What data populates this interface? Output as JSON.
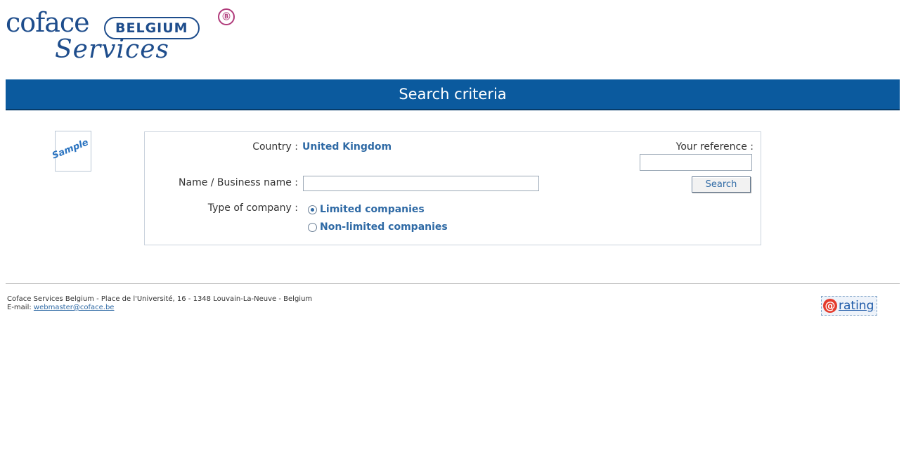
{
  "brand": {
    "logo_word": "coface",
    "country": "BELGIUM",
    "badge": "Ⓑ",
    "sub": "Services"
  },
  "header": {
    "title": "Search criteria"
  },
  "sample_stamp": "Sample",
  "form": {
    "country_label": "Country :",
    "country_value": "United Kingdom",
    "name_label": "Name / Business name :",
    "name_value": "",
    "type_label": "Type of company :",
    "types": [
      {
        "label": "Limited companies",
        "checked": true
      },
      {
        "label": "Non-limited companies",
        "checked": false
      }
    ],
    "reference_label": "Your reference :",
    "reference_value": "",
    "search_label": "Search"
  },
  "footer": {
    "address": "Coface Services Belgium - Place de l'Université, 16 - 1348 Louvain-La-Neuve - Belgium",
    "email_label": "E-mail:",
    "email": "webmaster@coface.be",
    "rating_at": "@",
    "rating_word": "rating"
  },
  "colors": {
    "header_bar": "#0b5a9e",
    "accent_text": "#2f6aa5",
    "brand": "#1e4d8c"
  }
}
